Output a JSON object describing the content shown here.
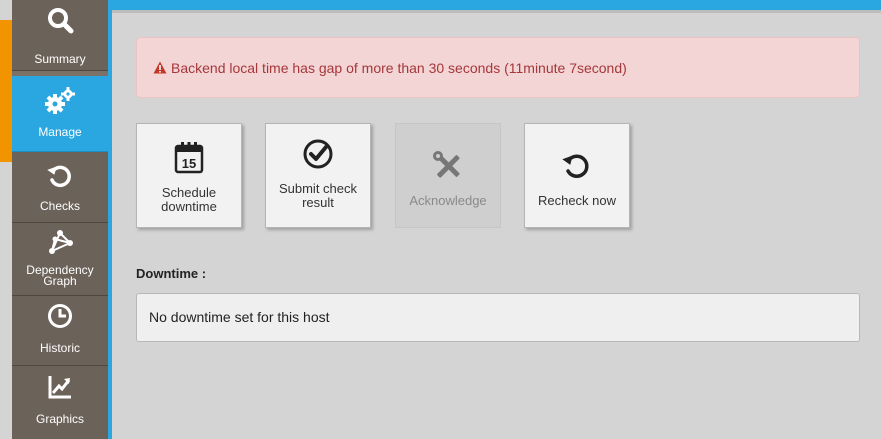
{
  "sidebar": {
    "items": [
      {
        "label": "Summary",
        "icon": "search-icon"
      },
      {
        "label": "Manage",
        "icon": "gears-icon",
        "active": true
      },
      {
        "label": "Checks",
        "icon": "refresh-icon"
      },
      {
        "label": "Dependency Graph",
        "label_line1": "Dependency",
        "label_line2": "Graph",
        "icon": "graph-icon"
      },
      {
        "label": "Historic",
        "icon": "clock-icon"
      },
      {
        "label": "Graphics",
        "icon": "line-chart-icon"
      }
    ]
  },
  "alert": {
    "text": "Backend local time has gap of more than 30 seconds (11minute 7second)",
    "color": "#a6373b"
  },
  "actions": [
    {
      "line1": "Schedule",
      "line2": "downtime",
      "icon": "calendar-icon",
      "calendar_day": "15",
      "enabled": true
    },
    {
      "line1": "Submit check",
      "line2": "result",
      "icon": "check-circle-icon",
      "enabled": true
    },
    {
      "line1": "Acknowledge",
      "line2": "",
      "icon": "tools-icon",
      "enabled": false
    },
    {
      "line1": "Recheck now",
      "line2": "",
      "icon": "refresh-icon",
      "enabled": true
    }
  ],
  "downtime": {
    "label": "Downtime :",
    "message": "No downtime set for this host"
  },
  "colors": {
    "accent": "#2aa6e0",
    "orange": "#f29400",
    "sidebar": "#6b6259"
  }
}
